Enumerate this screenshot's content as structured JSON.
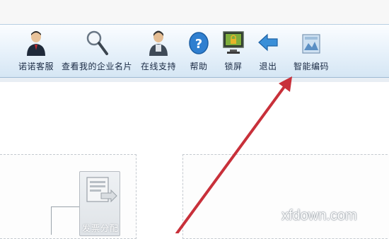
{
  "toolbar": {
    "items": [
      {
        "label": "诺诺客服",
        "icon": "customer-service-icon"
      },
      {
        "label": "查看我的企业名片",
        "icon": "magnifier-icon"
      },
      {
        "label": "在线支持",
        "icon": "online-support-icon"
      },
      {
        "label": "帮助",
        "icon": "help-icon"
      },
      {
        "label": "锁屏",
        "icon": "lock-screen-icon"
      },
      {
        "label": "退出",
        "icon": "exit-arrow-icon"
      },
      {
        "label": "智能编码",
        "icon": "smart-coding-icon"
      }
    ]
  },
  "workspace": {
    "node_label": "发票分配"
  },
  "watermark": "xfdown.com",
  "annotation": {
    "color": "#c8303a"
  }
}
